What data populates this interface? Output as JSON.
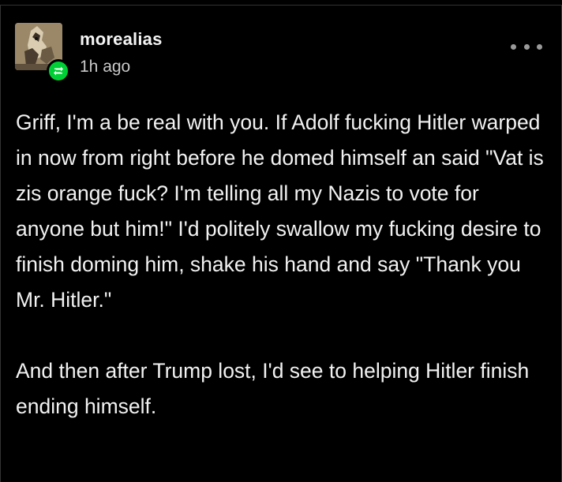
{
  "post": {
    "username": "morealias",
    "timestamp": "1h ago",
    "paragraphs": [
      "Griff, I'm a be real with you.  If Adolf fucking Hitler warped in now from right before he domed himself an said \"Vat is zis orange fuck?  I'm telling all my Nazis to vote for anyone but him!\" I'd politely swallow my fucking desire to finish doming him, shake his hand and say \"Thank you Mr. Hitler.\"",
      "And then after Trump lost, I'd see to helping Hitler finish ending himself."
    ]
  },
  "icons": {
    "avatar": "avatar-icon",
    "reblog": "reblog-icon",
    "more": "more-options-icon"
  },
  "colors": {
    "background": "#000000",
    "text": "#f2f2f2",
    "reblog_badge": "#00cf35",
    "timestamp": "#c8c8c8"
  }
}
